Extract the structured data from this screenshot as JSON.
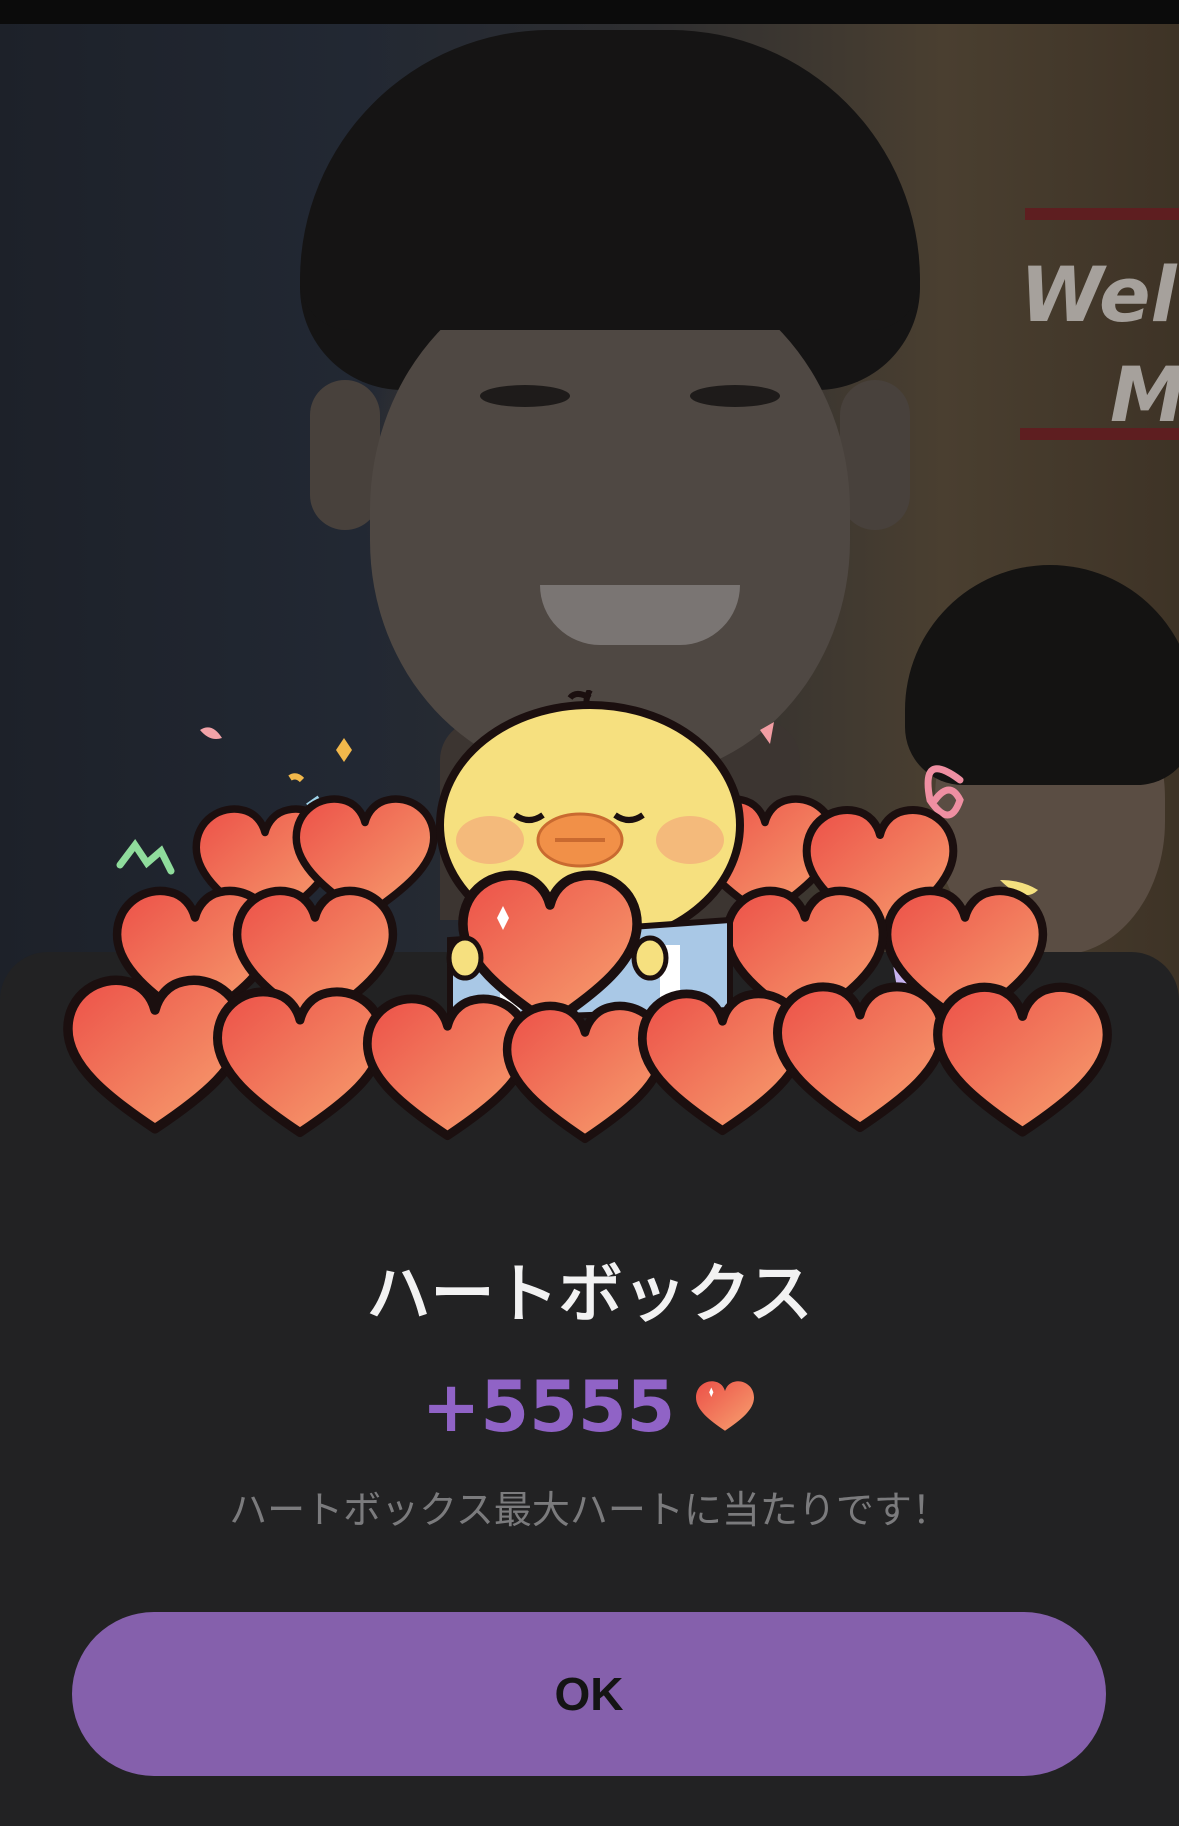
{
  "background": {
    "banner_text_line1": "Welc",
    "banner_text_line2": "M"
  },
  "dialog": {
    "title": "ハートボックス",
    "amount": "+5555",
    "amount_icon": "heart-icon",
    "message": "ハートボックス最大ハートに当たりです！",
    "ok_label": "OK"
  },
  "colors": {
    "accent": "#8560ac",
    "amount": "#9063c6",
    "sheet": "#222223",
    "heart": "#ef6a55"
  }
}
